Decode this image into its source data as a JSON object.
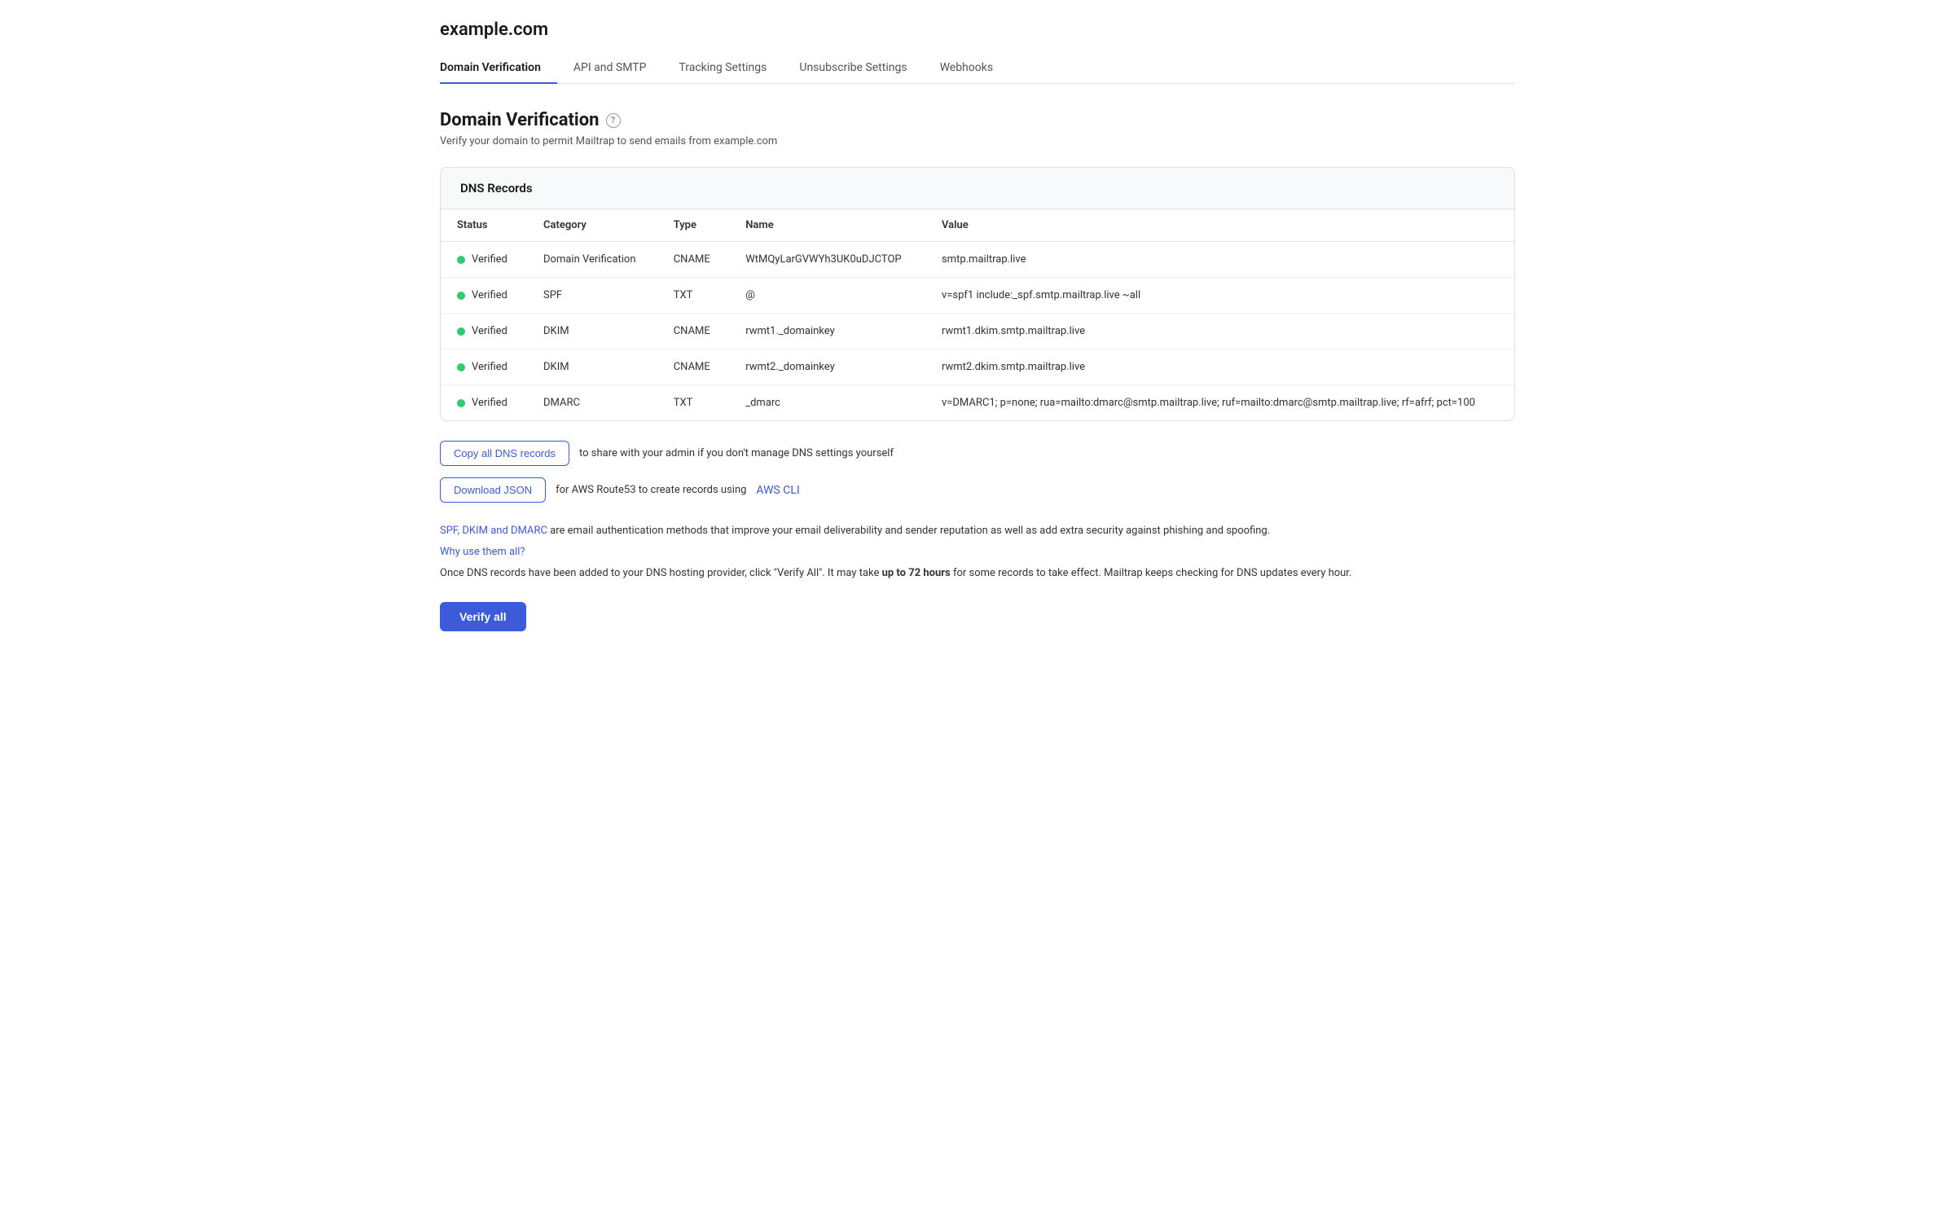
{
  "domain": {
    "name": "example.com"
  },
  "tabs": [
    {
      "id": "domain-verification",
      "label": "Domain Verification",
      "active": true
    },
    {
      "id": "api-smtp",
      "label": "API and SMTP",
      "active": false
    },
    {
      "id": "tracking-settings",
      "label": "Tracking Settings",
      "active": false
    },
    {
      "id": "unsubscribe-settings",
      "label": "Unsubscribe Settings",
      "active": false
    },
    {
      "id": "webhooks",
      "label": "Webhooks",
      "active": false
    }
  ],
  "page": {
    "title": "Domain Verification",
    "subtitle": "Verify your domain to permit Mailtrap to send emails from example.com",
    "help_icon": "?"
  },
  "dns_records": {
    "header": "DNS Records",
    "columns": {
      "status": "Status",
      "category": "Category",
      "type": "Type",
      "name": "Name",
      "value": "Value"
    },
    "rows": [
      {
        "status": "Verified",
        "status_color": "#2ecc71",
        "category": "Domain Verification",
        "type": "CNAME",
        "name": "WtMQyLarGVWYh3UK0uDJCTOP",
        "value": "smtp.mailtrap.live"
      },
      {
        "status": "Verified",
        "status_color": "#2ecc71",
        "category": "SPF",
        "type": "TXT",
        "name": "@",
        "value": "v=spf1 include:_spf.smtp.mailtrap.live ~all"
      },
      {
        "status": "Verified",
        "status_color": "#2ecc71",
        "category": "DKIM",
        "type": "CNAME",
        "name": "rwmt1._domainkey",
        "value": "rwmt1.dkim.smtp.mailtrap.live"
      },
      {
        "status": "Verified",
        "status_color": "#2ecc71",
        "category": "DKIM",
        "type": "CNAME",
        "name": "rwmt2._domainkey",
        "value": "rwmt2.dkim.smtp.mailtrap.live"
      },
      {
        "status": "Verified",
        "status_color": "#2ecc71",
        "category": "DMARC",
        "type": "TXT",
        "name": "_dmarc",
        "value": "v=DMARC1; p=none; rua=mailto:dmarc@smtp.mailtrap.live; ruf=mailto:dmarc@smtp.mailtrap.live; rf=afrf; pct=100"
      }
    ]
  },
  "actions": {
    "copy_button_label": "Copy all DNS records",
    "copy_text": "to share with your admin if you don't manage DNS settings yourself",
    "download_button_label": "Download JSON",
    "download_text": "for AWS Route53 to create records using",
    "aws_cli_label": "AWS CLI",
    "aws_cli_href": "#"
  },
  "info": {
    "spf_link_label": "SPF, DKIM and DMARC",
    "spf_text": " are email authentication methods that improve your email deliverability and sender reputation as well as add extra security against phishing and spoofing.",
    "why_link_label": "Why use them all?",
    "verify_text_before": "Once DNS records have been added to your DNS hosting provider, click \"Verify All\". It may take ",
    "verify_text_bold": "up to 72 hours",
    "verify_text_after": " for some records to take effect. Mailtrap keeps checking for DNS updates every hour."
  },
  "verify_button": {
    "label": "Verify all"
  }
}
